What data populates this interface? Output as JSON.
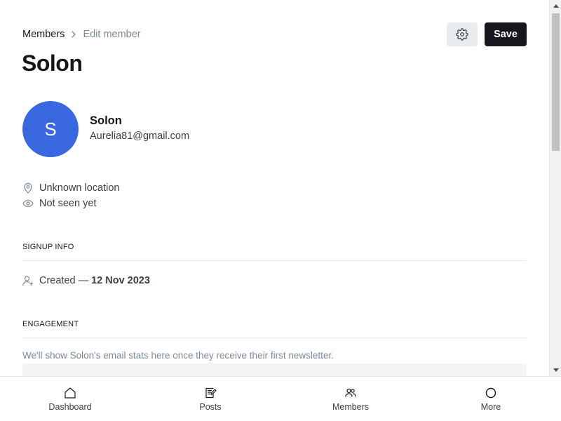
{
  "breadcrumb": {
    "parent": "Members",
    "current": "Edit member"
  },
  "page": {
    "title": "Solon"
  },
  "header_actions": {
    "settings_icon": "gear-icon",
    "save_label": "Save"
  },
  "member": {
    "initial": "S",
    "name": "Solon",
    "email": "Aurelia81@gmail.com",
    "avatar_color": "#3a68e0",
    "location": "Unknown location",
    "last_seen": "Not seen yet"
  },
  "signup": {
    "section_title": "SIGNUP INFO",
    "created_label": "Created",
    "created_sep": "—",
    "created_date": "12 Nov 2023"
  },
  "engagement": {
    "section_title": "ENGAGEMENT",
    "note": "We'll show Solon's email stats here once they receive their first newsletter."
  },
  "bottom_nav": {
    "items": [
      {
        "label": "Dashboard",
        "icon": "home-icon"
      },
      {
        "label": "Posts",
        "icon": "posts-icon"
      },
      {
        "label": "Members",
        "icon": "members-icon"
      },
      {
        "label": "More",
        "icon": "more-icon"
      }
    ]
  },
  "colors": {
    "primary_text": "#15171a",
    "secondary_text": "#7c8b9a",
    "save_button_bg": "#15171a",
    "settings_button_bg": "#e9ecef"
  }
}
